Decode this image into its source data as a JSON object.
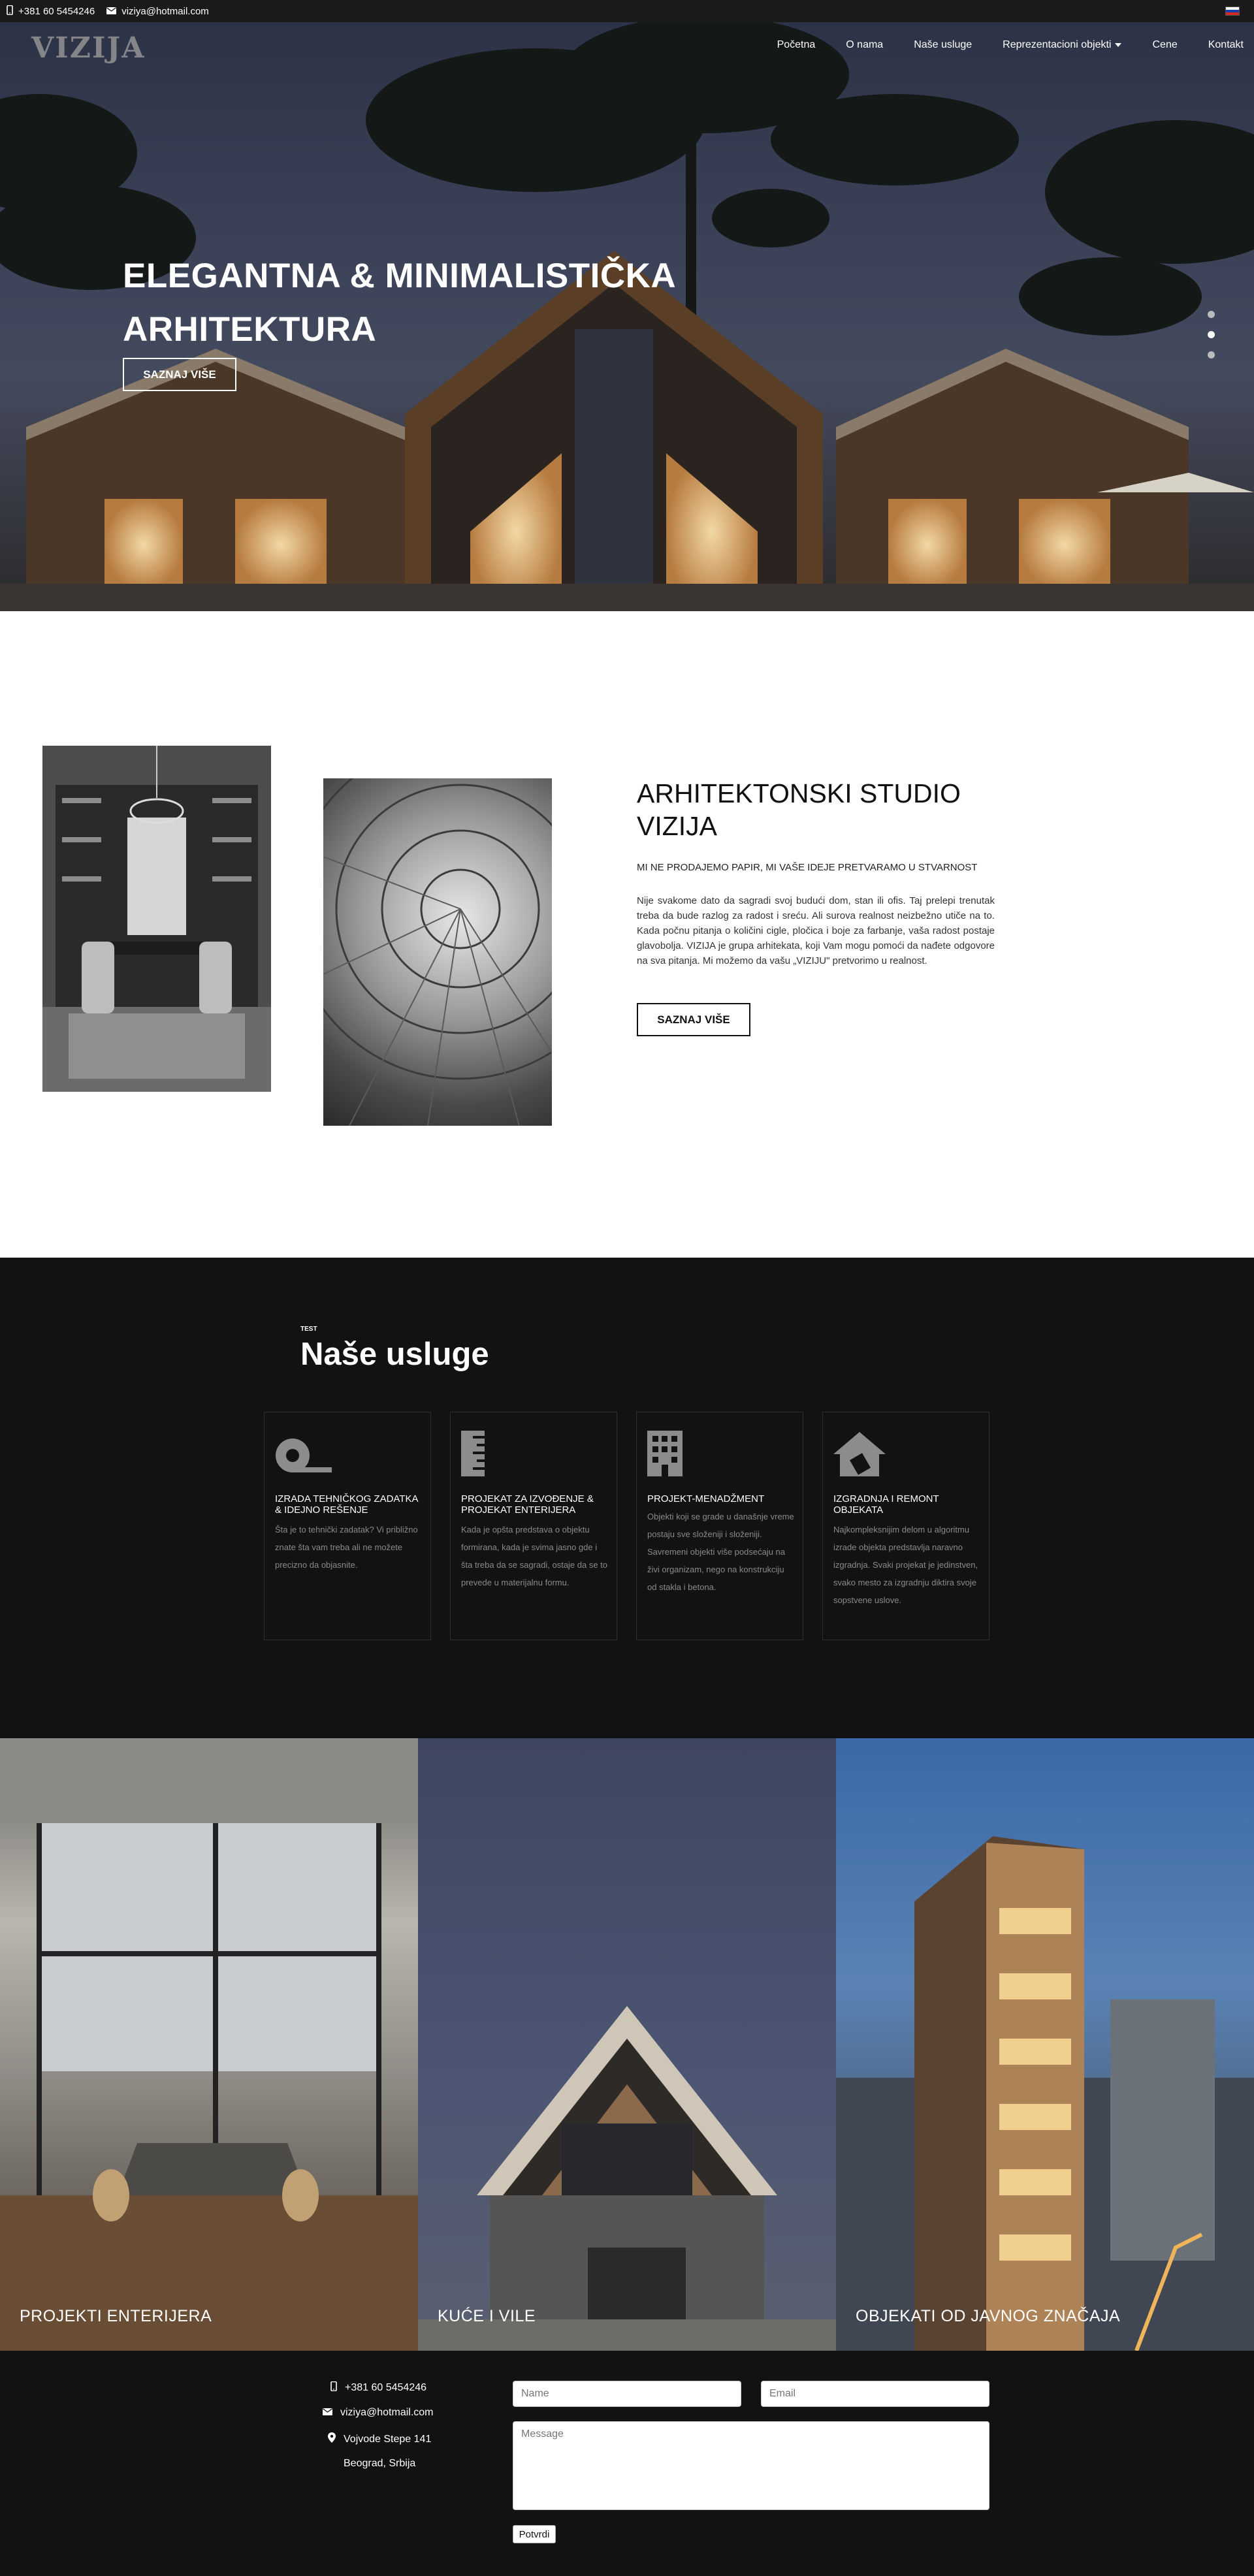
{
  "topbar": {
    "phone": "+381 60 5454246",
    "email": "viziya@hotmail.com",
    "flag_colors": [
      "#ffffff",
      "#1a3fb0",
      "#d52b1e"
    ]
  },
  "header": {
    "logo": "VIZIJA",
    "nav": [
      {
        "label": "Početna"
      },
      {
        "label": "O nama"
      },
      {
        "label": "Naše usluge"
      },
      {
        "label": "Reprezentacioni objekti"
      },
      {
        "label": "Cene"
      },
      {
        "label": "Kontakt"
      }
    ]
  },
  "hero": {
    "title_line1": "ELEGANTNA & MINIMALISTIČKA",
    "title_line2": "ARHITEKTURA",
    "button": "SAZNAJ VIŠE"
  },
  "about": {
    "title": "ARHITEKTONSKI STUDIO VIZIJA",
    "subtitle": "MI NE PRODAJEMO PAPIR, MI VAŠE IDEJE PRETVARAMO U STVARNOST",
    "text": "Nije svakome dato da sagradi svoj budući dom, stan ili ofis. Taj prelepi trenutak treba da bude razlog za radost i sreću. Ali surova realnost neizbežno utiče na to. Kada počnu pitanja o količini cigle, pločica i boje za farbanje, vaša radost postaje glavobolja. VIZIJA je grupa arhitekata, koji Vam mogu pomoći da nađete odgovore na sva pitanja. Mi možemo da vašu „VIZIJU\" pretvorimo u realnost.",
    "button": "SAZNAJ VIŠE"
  },
  "services": {
    "tag": "TEST",
    "title": "Naše usluge",
    "cards": [
      {
        "icon": "tape-measure-icon",
        "title": "IZRADA TEHNIČKOG ZADATKA & IDEJNO REŠENJE",
        "text": "Šta je to tehnički zadatak? Vi približno znate šta vam treba ali ne možete precizno da objasnite."
      },
      {
        "icon": "ruler-icon",
        "title": "PROJEKAT ZA IZVOĐENJE & PROJEKAT ENTERIJERA",
        "text": "Kada je opšta predstava o objektu formirana, kada je svima jasno gde i šta treba da se sagradi, ostaje da se to prevede u materijalnu formu."
      },
      {
        "icon": "building-icon",
        "title": "PROJEKT-MENADŽMENT",
        "text": "Objekti koji se grade u današnje vreme postaju sve složeniji i složeniji. Savremeni objekti više podsećaju na živi organizam, nego na konstrukciju od stakla i betona."
      },
      {
        "icon": "house-hammer-icon",
        "title": "IZGRADNJA I REMONT OBJEKATA",
        "text": "Najkompleksnijim delom u algoritmu izrade objekta predstavlja naravno izgradnja. Svaki projekat je jedinstven, svako mesto za izgradnju diktira svoje sopstvene uslove."
      }
    ]
  },
  "gallery": [
    {
      "caption": "PROJEKTI ENTERIJERA"
    },
    {
      "caption": "KUĆE I VILE"
    },
    {
      "caption": "OBJEKATI OD JAVNOG ZNAČAJA"
    }
  ],
  "footer": {
    "phone": "+381 60 5454246",
    "email": "viziya@hotmail.com",
    "address": "Vojvode Stepe 141",
    "city": "Beograd, Srbija",
    "name_placeholder": "Name",
    "email_placeholder": "Email",
    "message_placeholder": "Message",
    "submit": "Potvrdi"
  }
}
